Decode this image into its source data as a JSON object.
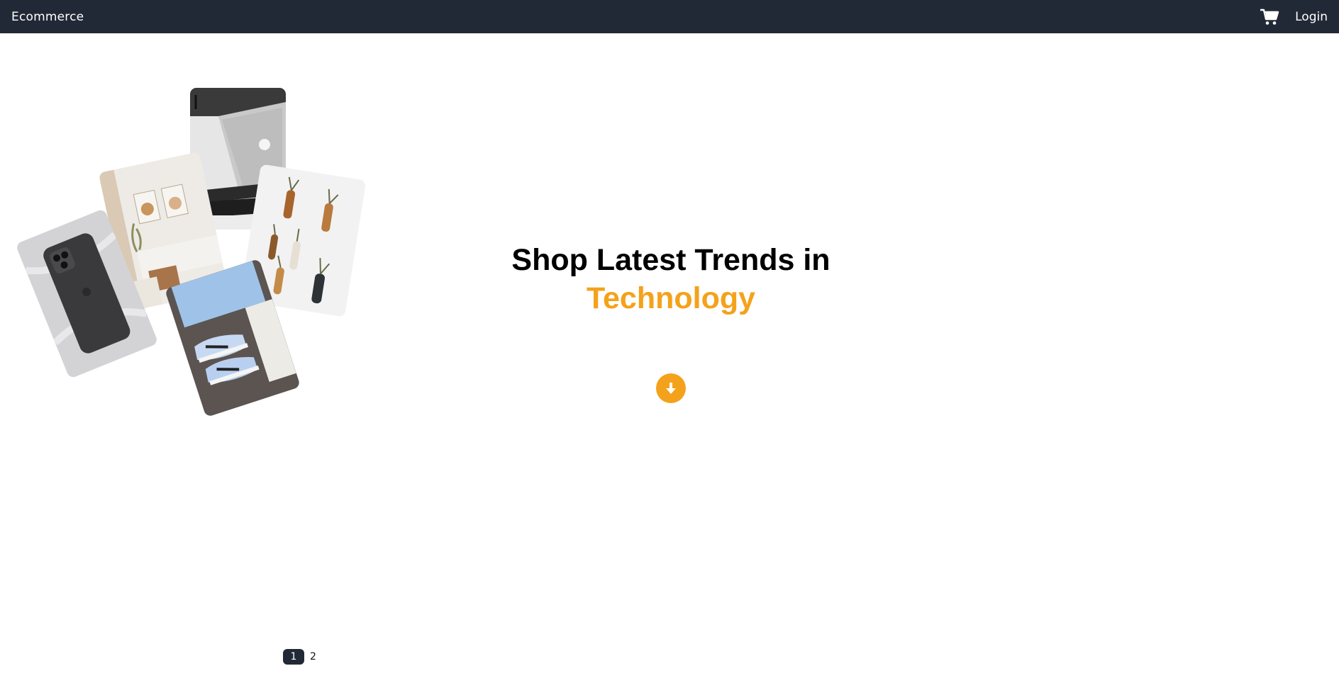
{
  "navbar": {
    "brand": "Ecommerce",
    "cart_icon": "shopping-cart-icon",
    "login_label": "Login"
  },
  "hero": {
    "line1": "Shop Latest Trends in",
    "line2": "Technology",
    "scroll_icon": "arrow-down-icon"
  },
  "collage": {
    "photos": [
      "laptop",
      "wall-art-room",
      "wall-vases",
      "smartphone",
      "sneakers"
    ]
  },
  "pagination": {
    "pages": [
      "1",
      "2"
    ],
    "current": "1"
  },
  "colors": {
    "navbar_bg": "#222936",
    "accent": "#f4a21b",
    "text": "#000000"
  }
}
